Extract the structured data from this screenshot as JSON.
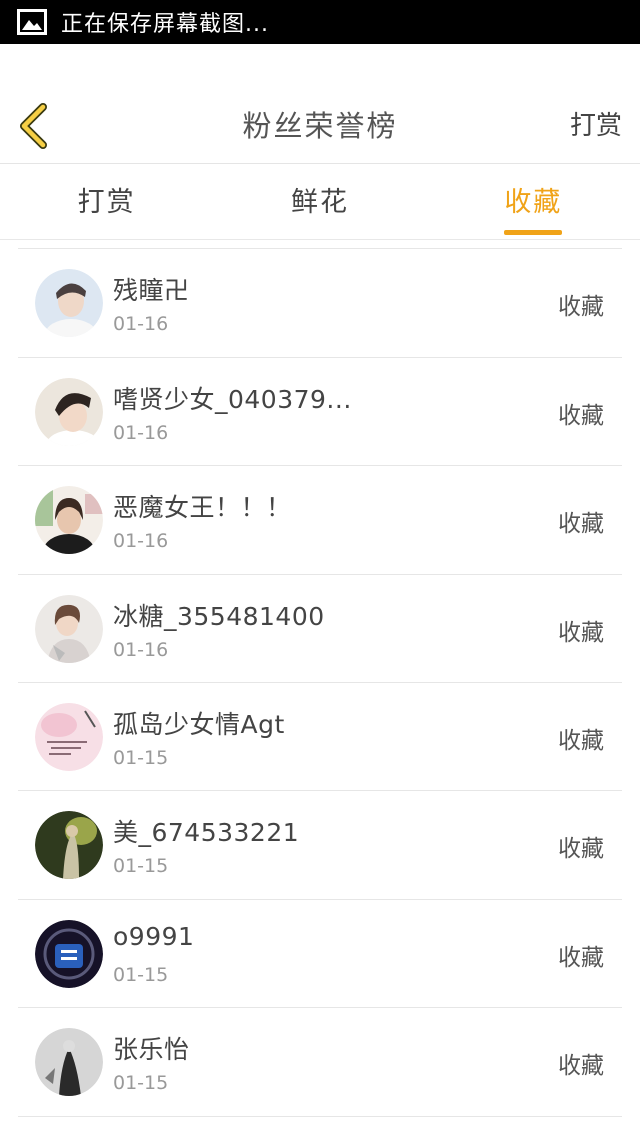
{
  "status_bar": {
    "icon": "image-icon",
    "text": "正在保存屏幕截图..."
  },
  "header": {
    "back_icon": "chevron-left-icon",
    "title": "粉丝荣誉榜",
    "action_label": "打赏"
  },
  "tabs": [
    {
      "label": "打赏",
      "active": false
    },
    {
      "label": "鲜花",
      "active": false
    },
    {
      "label": "收藏",
      "active": true
    }
  ],
  "colors": {
    "accent": "#f0a318",
    "divider": "#e6e6e6",
    "date_text": "#999999"
  },
  "list": [
    {
      "name": "",
      "date": "01-16",
      "type": "",
      "avatar": "avatar-dark"
    },
    {
      "name": "残瞳卍",
      "date": "01-16",
      "type": "收藏",
      "avatar": "avatar-male-light"
    },
    {
      "name": "嗜贤少女_040379...",
      "date": "01-16",
      "type": "收藏",
      "avatar": "avatar-male-dark-hair"
    },
    {
      "name": "恶魔女王！！！",
      "date": "01-16",
      "type": "收藏",
      "avatar": "avatar-female-selfie"
    },
    {
      "name": "冰糖_355481400",
      "date": "01-16",
      "type": "收藏",
      "avatar": "avatar-female-dress"
    },
    {
      "name": "孤岛少女情Agt",
      "date": "01-15",
      "type": "收藏",
      "avatar": "avatar-pink-art"
    },
    {
      "name": "美_674533221",
      "date": "01-15",
      "type": "收藏",
      "avatar": "avatar-green-photo"
    },
    {
      "name": "o9991",
      "date": "01-15",
      "type": "收藏",
      "avatar": "avatar-qing-character"
    },
    {
      "name": "张乐怡",
      "date": "01-15",
      "type": "收藏",
      "avatar": "avatar-grayscale-figure"
    }
  ]
}
